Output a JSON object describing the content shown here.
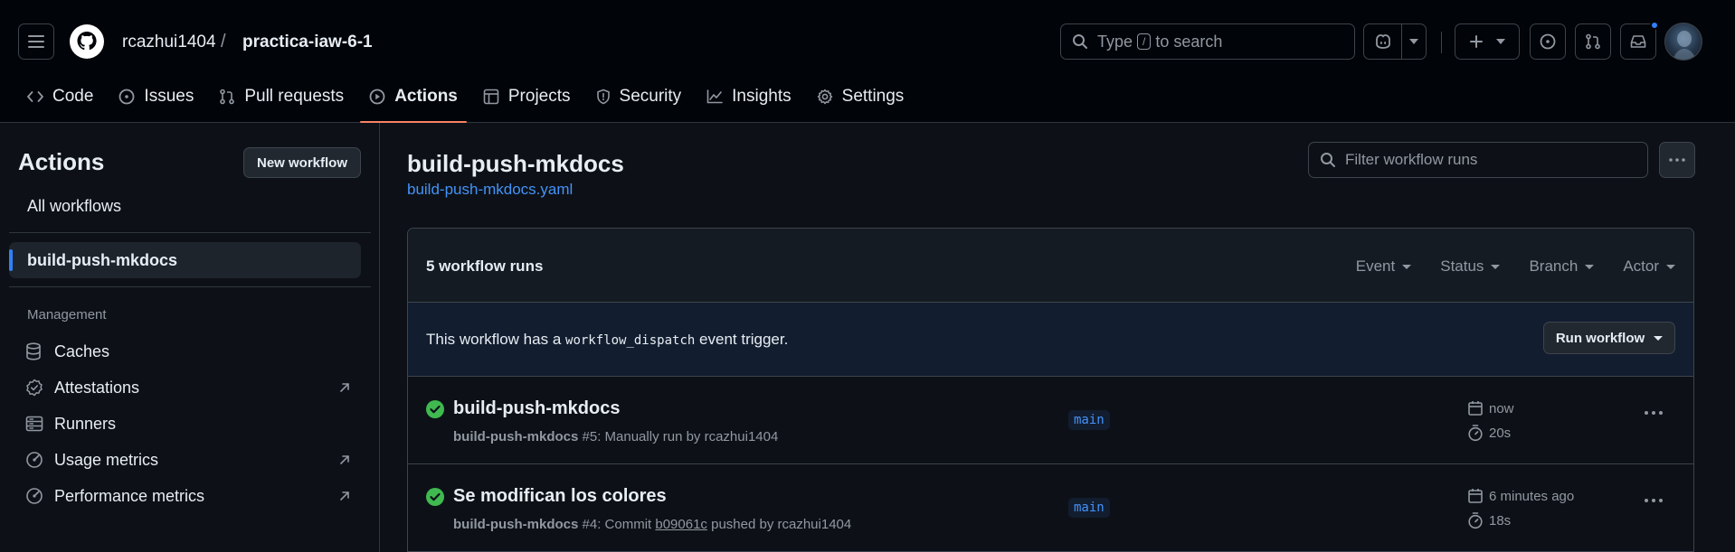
{
  "header": {
    "owner": "rcazhui1404",
    "separator": "/",
    "repo": "practica-iaw-6-1",
    "search": {
      "prefix": "Type",
      "key": "/",
      "suffix": "to search"
    }
  },
  "repo_tabs": [
    {
      "label": "Code",
      "icon": "code-icon"
    },
    {
      "label": "Issues",
      "icon": "issue-opened-icon"
    },
    {
      "label": "Pull requests",
      "icon": "git-pull-request-icon"
    },
    {
      "label": "Actions",
      "icon": "play-icon",
      "active": true
    },
    {
      "label": "Projects",
      "icon": "table-icon"
    },
    {
      "label": "Security",
      "icon": "shield-icon"
    },
    {
      "label": "Insights",
      "icon": "graph-icon"
    },
    {
      "label": "Settings",
      "icon": "gear-icon"
    }
  ],
  "sidebar": {
    "title": "Actions",
    "new_workflow": "New workflow",
    "all_workflows": "All workflows",
    "workflow_item": "build-push-mkdocs",
    "management_heading": "Management",
    "management": [
      {
        "label": "Caches",
        "icon": "database-icon",
        "external": false
      },
      {
        "label": "Attestations",
        "icon": "verified-icon",
        "external": true
      },
      {
        "label": "Runners",
        "icon": "server-icon",
        "external": false
      },
      {
        "label": "Usage metrics",
        "icon": "meter-icon",
        "external": true
      },
      {
        "label": "Performance metrics",
        "icon": "meter-icon",
        "external": true
      }
    ]
  },
  "main": {
    "title": "build-push-mkdocs",
    "file": "build-push-mkdocs.yaml",
    "filter_placeholder": "Filter workflow runs",
    "runs_count": "5 workflow runs",
    "filters": [
      "Event",
      "Status",
      "Branch",
      "Actor"
    ],
    "dispatch": {
      "before": "This workflow has a",
      "code": "workflow_dispatch",
      "after": "event trigger."
    },
    "run_workflow": "Run workflow",
    "runs": [
      {
        "title": "build-push-mkdocs",
        "workflow": "build-push-mkdocs",
        "number": "#5",
        "detail_before": ": Manually run by rcazhui1404",
        "sha": "",
        "detail_after": "",
        "branch": "main",
        "when": "now",
        "duration": "20s",
        "status": "success"
      },
      {
        "title": "Se modifican los colores",
        "workflow": "build-push-mkdocs",
        "number": "#4",
        "detail_before": ": Commit",
        "sha": "b09061c",
        "detail_after": "pushed by rcazhui1404",
        "branch": "main",
        "when": "6 minutes ago",
        "duration": "18s",
        "status": "success"
      }
    ]
  },
  "colors": {
    "accent_blue": "#4493f8",
    "success_green": "#3fb950",
    "active_tab_underline": "#f78166",
    "notification_dot": "#2f81f7"
  }
}
